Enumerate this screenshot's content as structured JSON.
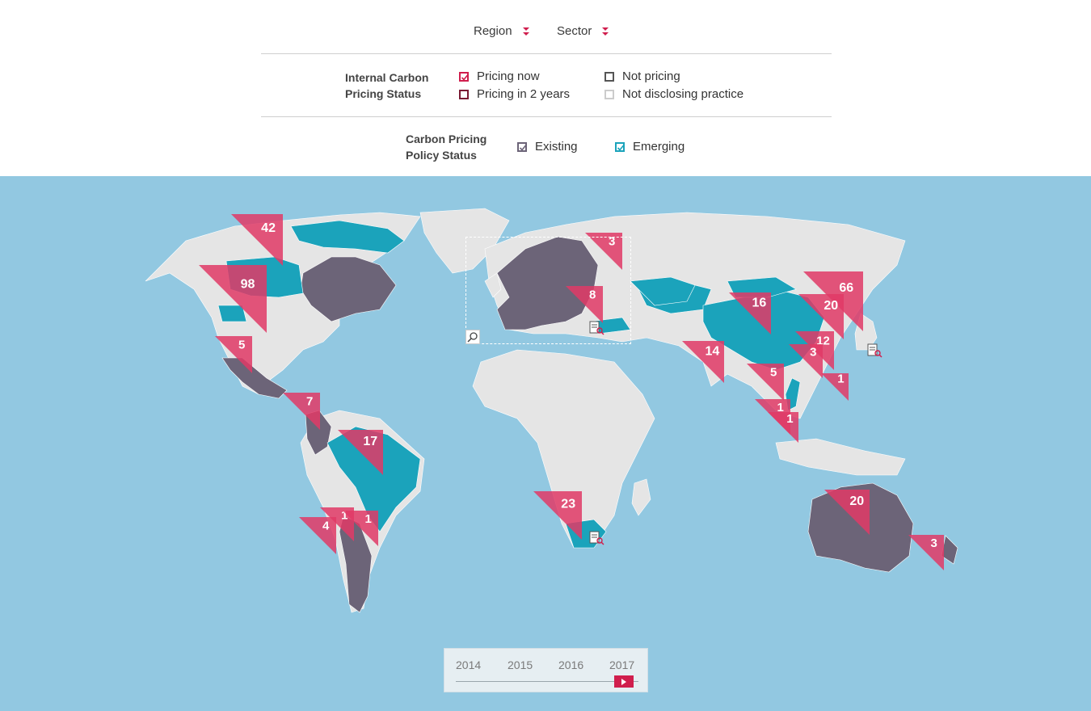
{
  "filters": {
    "region_label": "Region",
    "sector_label": "Sector"
  },
  "internal_pricing": {
    "title_line1": "Internal Carbon",
    "title_line2": "Pricing Status",
    "items": [
      {
        "label": "Pricing now",
        "checked": true,
        "color": "#d01e4d"
      },
      {
        "label": "Pricing in 2 years",
        "checked": false,
        "color": "#7a1a33"
      },
      {
        "label": "Not pricing",
        "checked": false,
        "color": "#555555"
      },
      {
        "label": "Not disclosing practice",
        "checked": false,
        "color": "#cccccc"
      }
    ]
  },
  "policy_status": {
    "title_line1": "Carbon Pricing",
    "title_line2": "Policy Status",
    "items": [
      {
        "label": "Existing",
        "checked": true,
        "color": "#6c6478"
      },
      {
        "label": "Emerging",
        "checked": true,
        "color": "#1ba3bb"
      }
    ]
  },
  "colors": {
    "ocean": "#92c8e1",
    "land": "#e5e5e5",
    "existing": "#6c6478",
    "emerging": "#1ba3bb",
    "marker": "#e03a66"
  },
  "markers": [
    {
      "value": "42",
      "region": "Canada north"
    },
    {
      "value": "98",
      "region": "Western Canada"
    },
    {
      "value": "5",
      "region": "California"
    },
    {
      "value": "7",
      "region": "Central America"
    },
    {
      "value": "17",
      "region": "Brazil"
    },
    {
      "value": "4",
      "region": "Peru"
    },
    {
      "value": "1",
      "region": "Bolivia"
    },
    {
      "value": "1",
      "region": "Paraguay"
    },
    {
      "value": "3",
      "region": "Russia west"
    },
    {
      "value": "8",
      "region": "Europe"
    },
    {
      "value": "23",
      "region": "South Africa"
    },
    {
      "value": "16",
      "region": "Central Asia"
    },
    {
      "value": "14",
      "region": "India"
    },
    {
      "value": "66",
      "region": "Japan"
    },
    {
      "value": "20",
      "region": "Korea"
    },
    {
      "value": "12",
      "region": "China east"
    },
    {
      "value": "3",
      "region": "China"
    },
    {
      "value": "5",
      "region": "Myanmar"
    },
    {
      "value": "1",
      "region": "Philippines"
    },
    {
      "value": "1",
      "region": "Malaysia"
    },
    {
      "value": "1",
      "region": "Singapore"
    },
    {
      "value": "20",
      "region": "Australia"
    },
    {
      "value": "3",
      "region": "New Zealand"
    }
  ],
  "timeline": {
    "years": [
      "2014",
      "2015",
      "2016",
      "2017"
    ],
    "selected": "2017"
  }
}
